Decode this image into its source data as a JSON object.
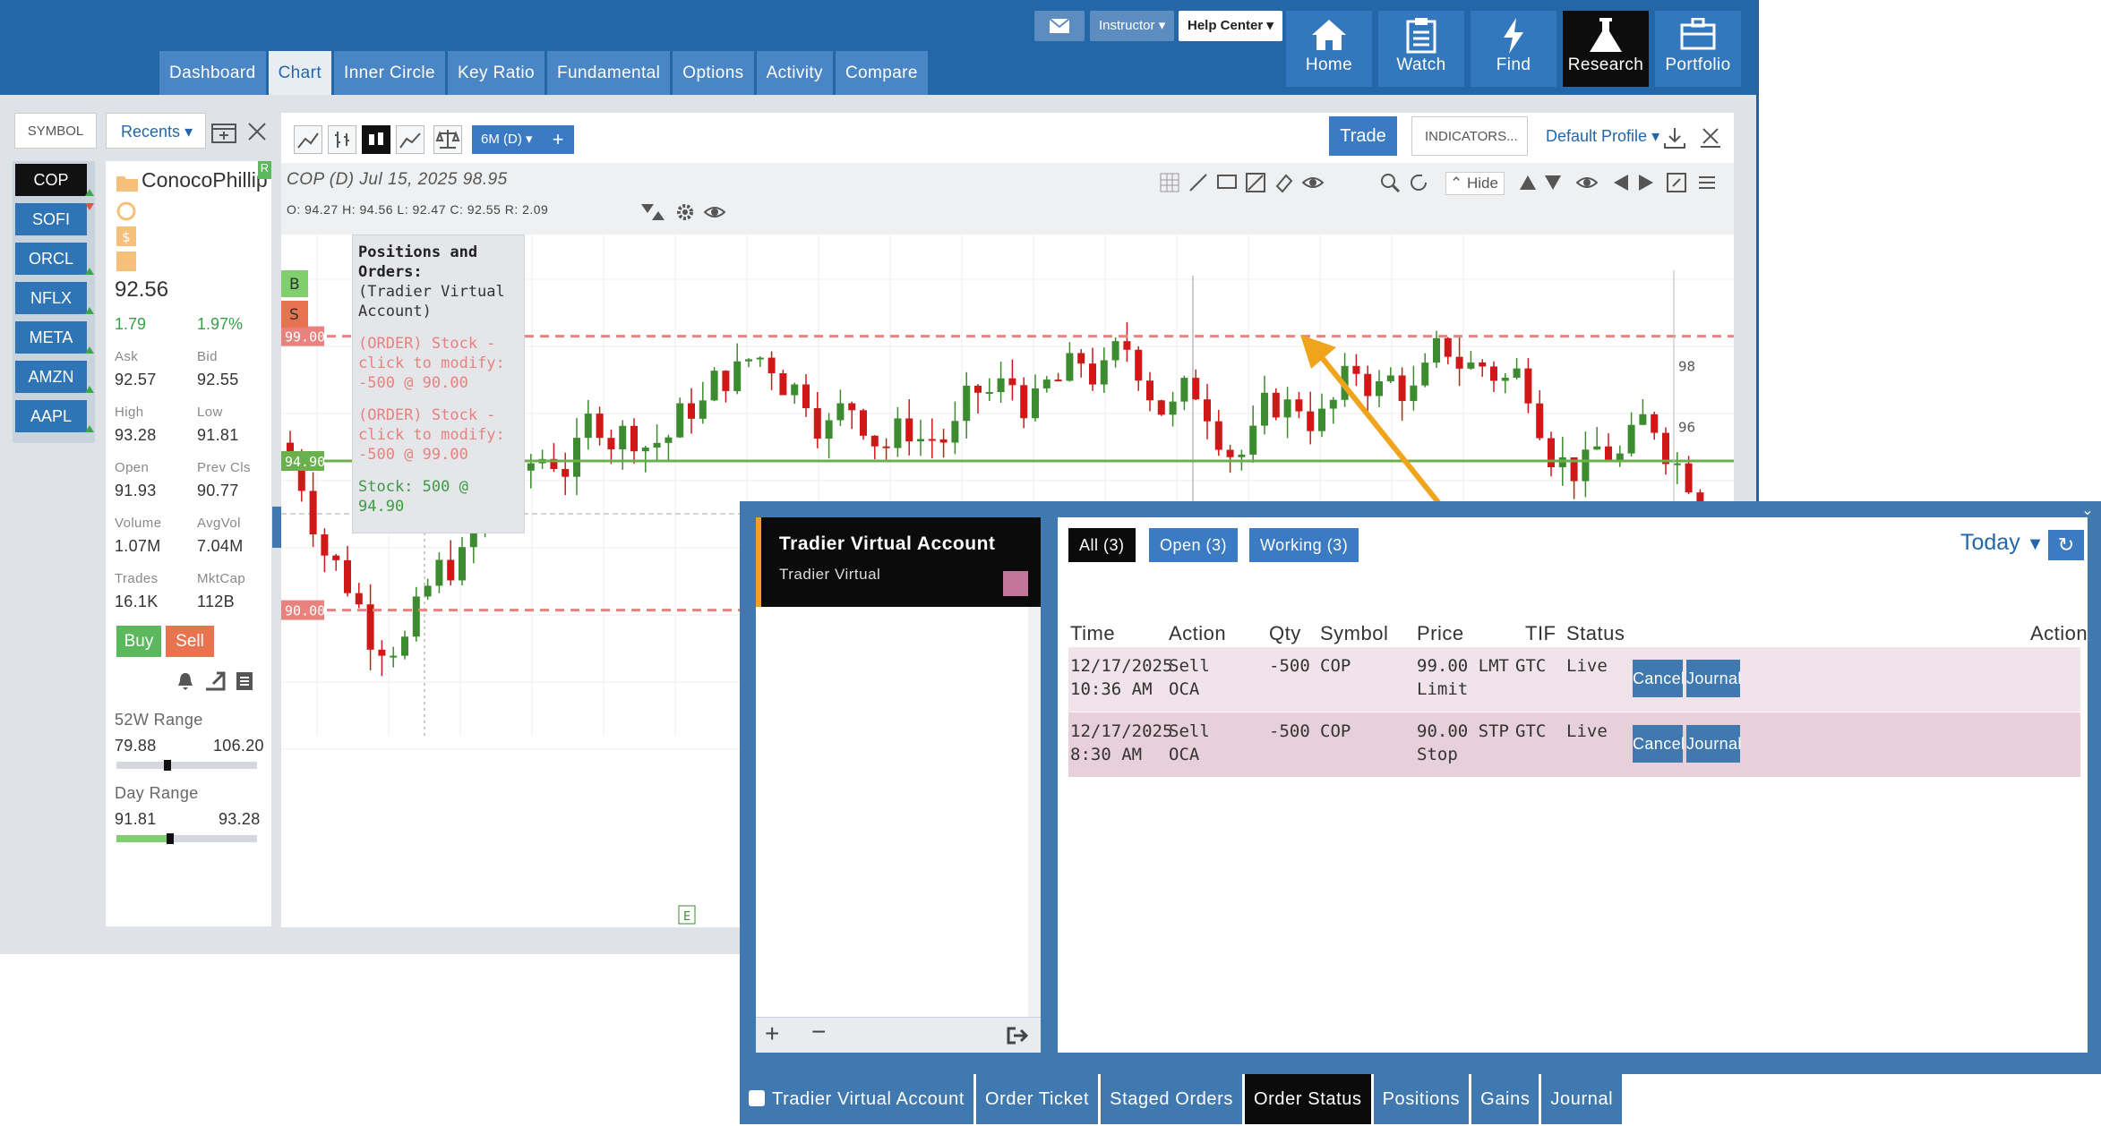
{
  "topbar": {
    "tabs": [
      "Dashboard",
      "Chart",
      "Inner Circle",
      "Key Ratio",
      "Fundamental",
      "Options",
      "Activity",
      "Compare"
    ],
    "active_tab": "Chart",
    "instructor_label": "Instructor",
    "help_label": "Help Center",
    "nav": [
      "Home",
      "Watch",
      "Find",
      "Research",
      "Portfolio"
    ],
    "active_nav": "Research"
  },
  "watchlist": {
    "header": "SYMBOL",
    "recents_label": "Recents",
    "symbols": [
      "COP",
      "SOFI",
      "ORCL",
      "NFLX",
      "META",
      "AMZN",
      "AAPL"
    ]
  },
  "quote": {
    "name": "ConocoPhillip",
    "badge": "R",
    "price": "92.56",
    "change": "1.79",
    "change_pct": "1.97%",
    "ask_label": "Ask",
    "ask": "92.57",
    "bid_label": "Bid",
    "bid": "92.55",
    "high_label": "High",
    "high": "93.28",
    "low_label": "Low",
    "low": "91.81",
    "open_label": "Open",
    "open": "91.93",
    "prevcls_label": "Prev Cls",
    "prevcls": "90.77",
    "volume_label": "Volume",
    "volume": "1.07M",
    "avgvol_label": "AvgVol",
    "avgvol": "7.04M",
    "trades_label": "Trades",
    "trades": "16.1K",
    "mktcap_label": "MktCap",
    "mktcap": "112B",
    "buy_label": "Buy",
    "sell_label": "Sell",
    "w52_label": "52W Range",
    "w52_low": "79.88",
    "w52_high": "106.20",
    "w52_position": 0.36,
    "day_label": "Day Range",
    "day_low": "91.81",
    "day_high": "93.28",
    "day_position": 0.38
  },
  "chart_toolbar": {
    "range_label": "6M (D)",
    "plus_label": "+",
    "trade_label": "Trade",
    "indicators_label": "INDICATORS...",
    "profile_label": "Default Profile",
    "hide_label": "Hide"
  },
  "chart_info": {
    "header": "COP  (D) Jul 15, 2025 98.95",
    "ohlc": "O: 94.27  H: 94.56  L: 92.47  C: 92.55  R: 2.09",
    "b_marker": "B",
    "s_marker": "S",
    "e_marker": "E"
  },
  "chart_data": {
    "type": "candlestick",
    "price_labels": [
      "99.00",
      "94.90",
      "90.00"
    ],
    "y_ticks": [
      "98",
      "96"
    ],
    "up_color": "#3d8b2f",
    "down_color": "#d01818",
    "order_line_color": "#e9827f",
    "position_line_color": "#6ab04c"
  },
  "positions_box": {
    "title": "Positions and Orders:",
    "subtitle": "(Tradier Virtual Account)",
    "order1": "(ORDER) Stock - click to modify: -500 @ 90.00",
    "order2": "(ORDER) Stock - click to modify: -500 @ 99.00",
    "stock": "Stock: 500 @ 94.90"
  },
  "trade_window": {
    "account_title": "Tradier Virtual Account",
    "account_sub": "Tradier Virtual",
    "filters": [
      "All (3)",
      "Open (3)",
      "Working (3)"
    ],
    "period": "Today",
    "headers": [
      "Time",
      "Action",
      "Qty",
      "Symbol",
      "Price",
      "TIF",
      "Status",
      "Action"
    ],
    "orders": [
      {
        "time1": "12/17/2025",
        "time2": "10:36 AM",
        "action1": "Sell",
        "action2": "OCA",
        "qty": "-500",
        "symbol": "COP",
        "price1": "99.00 LMT",
        "price2": "Limit",
        "tif": "GTC",
        "status": "Live",
        "cancel": "Cancel",
        "journal": "Journal"
      },
      {
        "time1": "12/17/2025",
        "time2": "8:30 AM",
        "action1": "Sell",
        "action2": "OCA",
        "qty": "-500",
        "symbol": "COP",
        "price1": "90.00 STP",
        "price2": "Stop",
        "tif": "GTC",
        "status": "Live",
        "cancel": "Cancel",
        "journal": "Journal"
      }
    ],
    "bottom_tabs": [
      "Tradier Virtual Account",
      "Order Ticket",
      "Staged Orders",
      "Order Status",
      "Positions",
      "Gains",
      "Journal"
    ],
    "active_bottom_tab": "Order Status"
  }
}
